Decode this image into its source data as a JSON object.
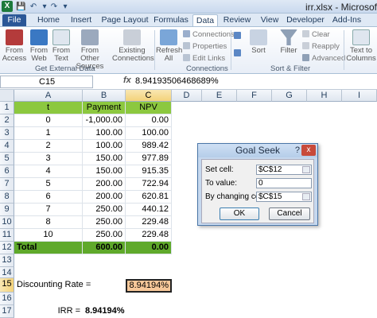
{
  "window": {
    "title": "irr.xlsx - Microsoft"
  },
  "quick_access": [
    "save-icon",
    "undo-icon",
    "redo-icon"
  ],
  "tabs": [
    {
      "label": "File"
    },
    {
      "label": "Home"
    },
    {
      "label": "Insert"
    },
    {
      "label": "Page Layout"
    },
    {
      "label": "Formulas"
    },
    {
      "label": "Data"
    },
    {
      "label": "Review"
    },
    {
      "label": "View"
    },
    {
      "label": "Developer"
    },
    {
      "label": "Add-Ins"
    }
  ],
  "ribbon": {
    "from_access": "From Access",
    "from_web": "From Web",
    "from_text": "From Text",
    "from_other": "From Other Sources",
    "existing": "Existing Connections",
    "group_external": "Get External Data",
    "refresh_all": "Refresh All",
    "connections": "Connections",
    "properties": "Properties",
    "edit_links": "Edit Links",
    "group_connections": "Connections",
    "sort": "Sort",
    "filter": "Filter",
    "clear": "Clear",
    "reapply": "Reapply",
    "advanced": "Advanced",
    "group_sort": "Sort & Filter",
    "text_to_columns": "Text to Columns"
  },
  "formula_bar": {
    "name_box": "C15",
    "fx": "fx",
    "formula": "8.94193506468689%"
  },
  "columns": [
    "A",
    "B",
    "C",
    "D",
    "E",
    "F",
    "G",
    "H",
    "I"
  ],
  "rows": [
    "1",
    "2",
    "3",
    "4",
    "5",
    "6",
    "7",
    "8",
    "9",
    "10",
    "11",
    "12",
    "13",
    "14",
    "15",
    "16",
    "17",
    "18"
  ],
  "table": {
    "headers": [
      "t",
      "Payment",
      "NPV"
    ],
    "data": [
      [
        "0",
        "-1,000.00",
        "0.00"
      ],
      [
        "1",
        "100.00",
        "100.00"
      ],
      [
        "2",
        "100.00",
        "989.42"
      ],
      [
        "3",
        "150.00",
        "977.89"
      ],
      [
        "4",
        "150.00",
        "915.35"
      ],
      [
        "5",
        "200.00",
        "722.94"
      ],
      [
        "6",
        "200.00",
        "620.81"
      ],
      [
        "7",
        "250.00",
        "440.12"
      ],
      [
        "8",
        "250.00",
        "229.48"
      ],
      [
        "10",
        "250.00",
        "229.48"
      ]
    ],
    "total": [
      "Total",
      "600.00",
      "0.00"
    ]
  },
  "extra": {
    "discount_label": "Discounting Rate =",
    "discount_value": "8.94194%",
    "irr_label": "IRR =",
    "irr_value": "8.94194%"
  },
  "dialog": {
    "title": "Goal Seek",
    "help": "?",
    "close": "x",
    "set_cell_label": "Set cell:",
    "set_cell_value": "$C$12",
    "to_value_label": "To value:",
    "to_value_value": "0",
    "changing_label": "By changing cell:",
    "changing_value": "$C$15",
    "ok": "OK",
    "cancel": "Cancel"
  },
  "colors": {
    "header_fill": "#8cc83f",
    "total_fill": "#5fa92b",
    "active_fill": "#f7c89a",
    "file_tab": "#2b5797"
  }
}
